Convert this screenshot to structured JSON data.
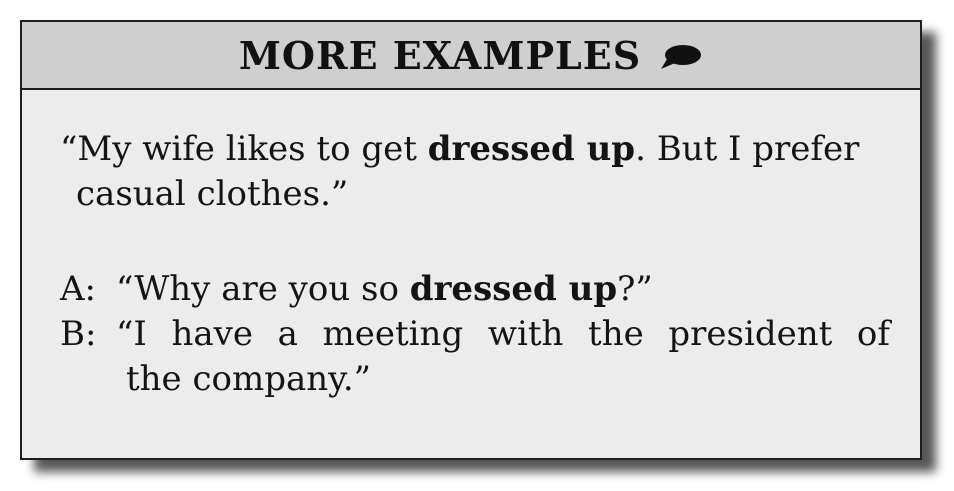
{
  "header": {
    "title": "MORE EXAMPLES",
    "icon": "speech-bubble-icon"
  },
  "example1": {
    "line1_before": "“My wife likes to get ",
    "line1_bold": "dressed up",
    "line1_after": ". But I prefer",
    "line2": "casual clothes.”"
  },
  "dialog": {
    "a_speaker": "A:",
    "a_before": "“Why are you so ",
    "a_bold": "dressed up",
    "a_after": "?”",
    "b_speaker": "B:",
    "b_line1": "“I have a meeting with the president of",
    "b_line2": "the company.”"
  },
  "colors": {
    "header_background": "#cfcfcf",
    "card_background": "#ececec",
    "border": "#1e1e1e",
    "text": "#141414"
  }
}
